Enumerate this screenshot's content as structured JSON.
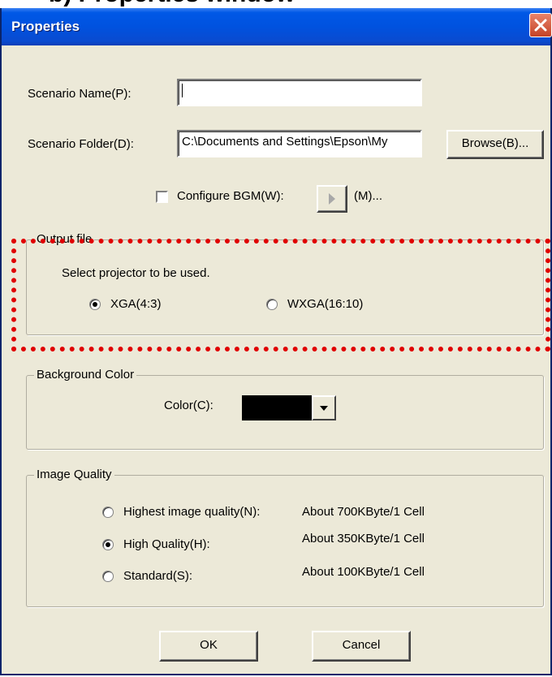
{
  "partial_heading": "b) Properties window",
  "window": {
    "title": "Properties"
  },
  "scenario": {
    "name_label": "Scenario Name(P):",
    "name_value": "",
    "folder_label": "Scenario Folder(D):",
    "folder_value": "C:\\Documents and Settings\\Epson\\My",
    "browse_label": "Browse(B)..."
  },
  "bgm": {
    "checkbox_label": "Configure BGM(W):",
    "checked": false,
    "music_label": "(M)..."
  },
  "output_file": {
    "group_label": "Output file",
    "instruction": "Select projector to be used.",
    "options": [
      {
        "label": "XGA(4:3)",
        "selected": true
      },
      {
        "label": "WXGA(16:10)",
        "selected": false
      }
    ]
  },
  "background_color": {
    "group_label": "Background Color",
    "color_label": "Color(C):",
    "selected_color": "#000000"
  },
  "image_quality": {
    "group_label": "Image Quality",
    "options": [
      {
        "label": "Highest image quality(N):",
        "size": "About 700KByte/1 Cell",
        "selected": false
      },
      {
        "label": "High Quality(H):",
        "size": "About 350KByte/1 Cell",
        "selected": true
      },
      {
        "label": "Standard(S):",
        "size": "About 100KByte/1 Cell",
        "selected": false
      }
    ]
  },
  "buttons": {
    "ok": "OK",
    "cancel": "Cancel"
  },
  "colors": {
    "highlight": "#e00000",
    "titlebar": "#0058e6",
    "dialog_bg": "#ece9d8"
  }
}
